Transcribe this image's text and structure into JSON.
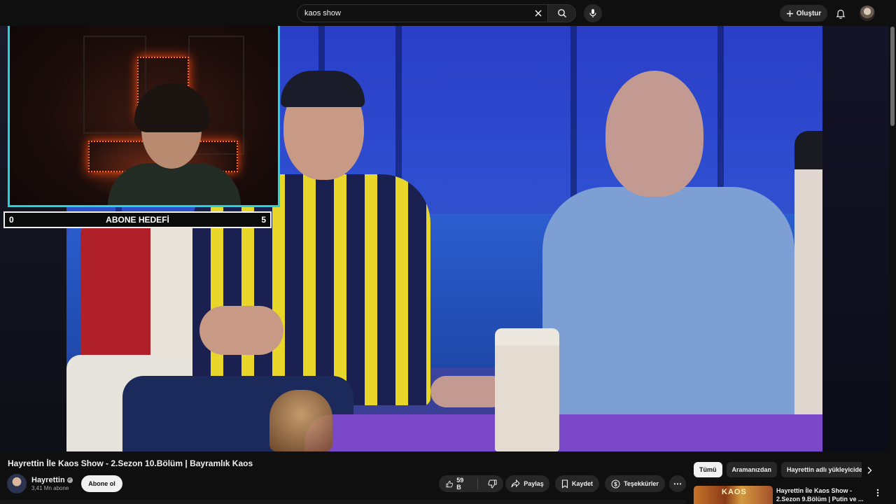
{
  "topbar": {
    "search_value": "kaos show",
    "search_icon": "search-icon",
    "clear_icon": "close-icon",
    "mic_icon": "microphone-icon",
    "create_label": "Oluştur",
    "bell_icon": "bell-icon",
    "avatar_icon": "account-avatar"
  },
  "overlay": {
    "goal_title": "ABONE HEDEFİ",
    "goal_current": "0",
    "goal_target": "5"
  },
  "video": {
    "title": "Hayrettin İle Kaos Show - 2.Sezon 10.Bölüm | Bayramlık Kaos",
    "channel": "Hayrettin",
    "subscribers": "3,41 Mn abone",
    "subscribe_label": "Abone ol",
    "like_count": "59 B",
    "share_label": "Paylaş",
    "save_label": "Kaydet",
    "thanks_label": "Teşekkürler",
    "more_label": "⋯"
  },
  "chips": [
    "Tümü",
    "Aramanızdan",
    "Hayrettin adlı yükleyiciden"
  ],
  "recommendation": {
    "title": "Hayrettin İle Kaos Show - 2.Sezon 9.Bölüm | Putin ve ...",
    "thumb_text": "KAOS"
  },
  "colors": {
    "background": "#0f0f0f",
    "pill": "#272727",
    "webcam_border": "#22d3e0",
    "text": "#f1f1f1",
    "muted": "#aaaaaa"
  }
}
